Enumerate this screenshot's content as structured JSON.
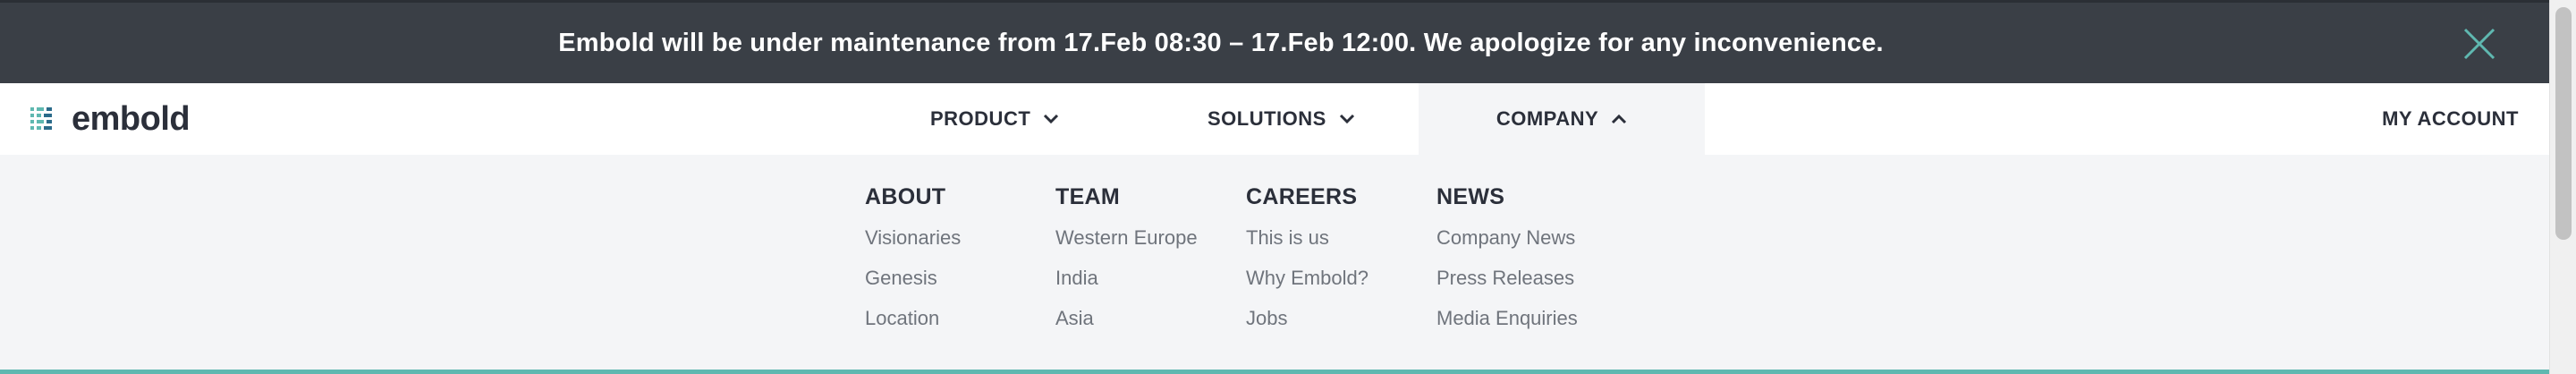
{
  "banner": {
    "message": "Embold will be under maintenance from 17.Feb 08:30 – 17.Feb 12:00. We apologize for any inconvenience.",
    "close_icon": "close-icon"
  },
  "header": {
    "logo_text": "embold",
    "nav": [
      {
        "label": "PRODUCT",
        "icon": "chevron-down-icon"
      },
      {
        "label": "SOLUTIONS",
        "icon": "chevron-down-icon"
      },
      {
        "label": "COMPANY",
        "icon": "chevron-up-icon"
      }
    ],
    "my_account": "MY ACCOUNT"
  },
  "mega_menu": {
    "columns": [
      {
        "title": "ABOUT",
        "links": [
          "Visionaries",
          "Genesis",
          "Location"
        ]
      },
      {
        "title": "TEAM",
        "links": [
          "Western Europe",
          "India",
          "Asia"
        ]
      },
      {
        "title": "CAREERS",
        "links": [
          "This is us",
          "Why Embold?",
          "Jobs"
        ]
      },
      {
        "title": "NEWS",
        "links": [
          "Company News",
          "Press Releases",
          "Media Enquiries"
        ]
      }
    ]
  },
  "colors": {
    "banner_bg": "#3a3f46",
    "close_accent": "#5fb8b0",
    "text_dark": "#2b2f3a",
    "link_gray": "#6f747c",
    "menu_bg": "#f4f5f7"
  }
}
